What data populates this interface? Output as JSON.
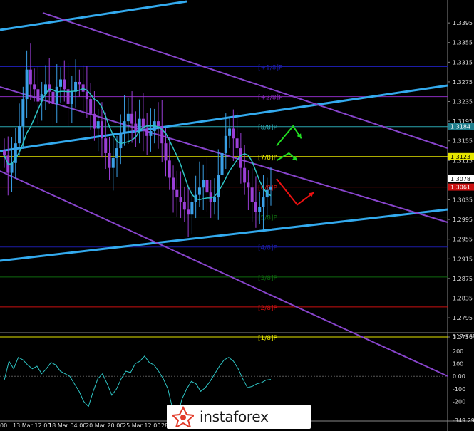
{
  "chart_data": {
    "type": "line",
    "subtype": "candlestick",
    "main": {
      "price_axis_ticks": [
        "1.3395",
        "1.3355",
        "1.3315",
        "1.3275",
        "1.3235",
        "1.3195",
        "1.3155",
        "1.3115",
        "1.3078",
        "1.3035",
        "1.2995",
        "1.2955",
        "1.2915",
        "1.2875",
        "1.2835",
        "1.2795",
        "1.2756"
      ],
      "price_range": [
        1.2756,
        1.343
      ],
      "highlighted_prices": [
        {
          "label": "1.3184",
          "color": "#1e7d8c"
        },
        {
          "label": "1.3123",
          "color": "#e6e600"
        },
        {
          "label": "1.3078",
          "color": "#ffffff"
        },
        {
          "label": "1.3061",
          "color": "#cc1111"
        }
      ],
      "murrey_levels": [
        {
          "label": "[+1/8]P",
          "price": 1.3306,
          "color": "#1c1ca8"
        },
        {
          "label": "[+2/8]P",
          "price": 1.3245,
          "color": "#8a2bbf"
        },
        {
          "label": "[8/8]P",
          "price": 1.3184,
          "color": "#2aa6b0"
        },
        {
          "label": "[7/8]P",
          "price": 1.3123,
          "color": "#e6e600"
        },
        {
          "label": "[6/8]P",
          "price": 1.3061,
          "color": "#cc1111"
        },
        {
          "label": "[5/8]P",
          "price": 1.3,
          "color": "#0f6a0f"
        },
        {
          "label": "[4/8]P",
          "price": 1.2939,
          "color": "#1c1ca8"
        },
        {
          "label": "[3/8]P",
          "price": 1.2878,
          "color": "#0f6a0f"
        },
        {
          "label": "[2/8]P",
          "price": 1.2817,
          "color": "#cc1111"
        },
        {
          "label": "[1/8]P",
          "price": 1.2756,
          "color": "#e6e600"
        }
      ],
      "date_labels": [
        "00",
        "13 Mar 12:00",
        "18 Mar 04:00",
        "20 Mar 20:00",
        "25 Mar 12:00",
        "28 Ma"
      ],
      "closes": [
        1.3125,
        1.309,
        1.311,
        1.315,
        1.3185,
        1.324,
        1.33,
        1.327,
        1.326,
        1.3235,
        1.325,
        1.327,
        1.3255,
        1.323,
        1.3265,
        1.328,
        1.326,
        1.323,
        1.3255,
        1.3275,
        1.327,
        1.3255,
        1.324,
        1.321,
        1.318,
        1.3195,
        1.316,
        1.313,
        1.31,
        1.312,
        1.314,
        1.317,
        1.3195,
        1.321,
        1.319,
        1.3175,
        1.32,
        1.318,
        1.3165,
        1.3175,
        1.3195,
        1.3185,
        1.315,
        1.3115,
        1.308,
        1.3055,
        1.304,
        1.303,
        1.3015,
        1.3005,
        1.303,
        1.3045,
        1.306,
        1.3075,
        1.305,
        1.303,
        1.304,
        1.3085,
        1.313,
        1.3165,
        1.318,
        1.316,
        1.314,
        1.31,
        1.307,
        1.306,
        1.303,
        1.301,
        1.302,
        1.304,
        1.3055,
        1.3062
      ],
      "signal_arrows": [
        {
          "color": "#22dd22",
          "points": [
            [
              1.3115,
              0
            ],
            [
              1.313,
              3
            ],
            [
              1.3115,
              5
            ]
          ]
        },
        {
          "color": "#22dd22",
          "points": [
            [
              1.3145,
              0
            ],
            [
              1.3185,
              4
            ],
            [
              1.316,
              6
            ]
          ]
        },
        {
          "color": "#ee1111",
          "points": [
            [
              1.3078,
              0
            ],
            [
              1.3025,
              5
            ],
            [
              1.305,
              9
            ]
          ]
        }
      ]
    },
    "oscillator": {
      "axis_ticks": [
        "317.7683",
        "200",
        "100",
        "0.00",
        "-100",
        "-200",
        "-349.291"
      ],
      "range": [
        -349.291,
        317.7683
      ],
      "values": [
        -30,
        120,
        60,
        150,
        130,
        90,
        60,
        80,
        20,
        60,
        110,
        90,
        40,
        20,
        0,
        -60,
        -120,
        -200,
        -240,
        -120,
        -20,
        20,
        -60,
        -150,
        -100,
        -20,
        40,
        30,
        100,
        120,
        160,
        110,
        90,
        40,
        -20,
        -100,
        -260,
        -320,
        -180,
        -100,
        -40,
        -60,
        -120,
        -90,
        -40,
        20,
        80,
        130,
        150,
        120,
        60,
        -20,
        -90,
        -80,
        -60,
        -50,
        -30,
        -25
      ]
    }
  },
  "watermark": {
    "brand": "instaforex"
  }
}
